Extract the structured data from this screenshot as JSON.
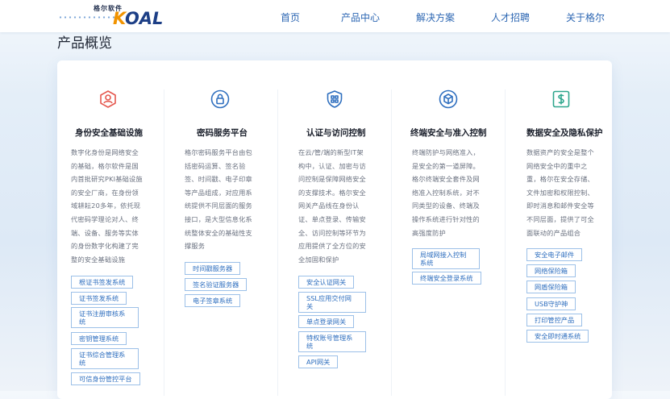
{
  "header": {
    "logo_cn": "格尔软件",
    "logo_brand_k": "K",
    "logo_brand_rest": "OAL",
    "nav": [
      "首页",
      "产品中心",
      "解决方案",
      "人才招聘",
      "关于格尔"
    ]
  },
  "page_title": "产品概览",
  "colors": {
    "accent": "#2f6fbf",
    "icon_red": "#e5584f",
    "icon_blue": "#2f6fbf",
    "icon_green": "#2ea68d"
  },
  "columns": [
    {
      "icon": "user-shield-icon",
      "title": "身份安全基础设施",
      "desc": [
        "数字化身份是网络安全",
        "的基础，格尔软件是国",
        "内首批研究PKI基础设施",
        "的安全厂商，在身份领",
        "域耕耘20多年，依托现",
        "代密码学理论对人、终",
        "端、设备、服务等实体",
        "的身份数字化构建了完",
        "整的安全基础设施"
      ],
      "tags": [
        "根证书签发系统",
        "证书签发系统",
        "证书注册审核系统",
        "密钥管理系统",
        "证书综合管理系统",
        "可信身份管控平台"
      ]
    },
    {
      "icon": "lock-icon",
      "title": "密码服务平台",
      "desc": [
        "格尔密码服务平台由包",
        "括密码运算、签名验",
        "签、时间戳、电子印章",
        "等产品组成，对应用系",
        "统提供不同层面的服务",
        "接口，是大型信息化系",
        "统整体安全的基础性支",
        "撑服务"
      ],
      "tags": [
        "时间戳服务器",
        "签名验证服务器",
        "电子签章系统"
      ]
    },
    {
      "icon": "shield-access-icon",
      "title": "认证与访问控制",
      "desc": [
        "在云/管/端的新型IT架",
        "构中，认证、加密与访",
        "问控制是保障网络安全",
        "的支撑技术。格尔安全",
        "网关产品线在身份认",
        "证、单点登录、传输安",
        "全、访问控制等环节为",
        "应用提供了全方位的安",
        "全加固和保护"
      ],
      "tags": [
        "安全认证网关",
        "SSL应用交付网关",
        "单点登录网关",
        "特权账号管理系统",
        "API网关"
      ]
    },
    {
      "icon": "cube-icon",
      "title": "终端安全与准入控制",
      "desc": [
        "终端防护与网络准入，",
        "是安全的第一道屏障。",
        "格尔终端安全套件及网",
        "络准入控制系统，对不",
        "同类型的设备、终端及",
        "操作系统进行针对性的",
        "高强度防护"
      ],
      "tags": [
        "局域网接入控制系统",
        "终端安全登录系统"
      ]
    },
    {
      "icon": "data-privacy-icon",
      "title": "数据安全及隐私保护",
      "desc": [
        "数据资产的安全是整个",
        "网络安全中的重中之",
        "重，格尔在安全存储、",
        "文件加密和权限控制、",
        "即时消息和邮件安全等",
        "不同层面，提供了可全",
        "面联动的产品组合"
      ],
      "tags": [
        "安全电子邮件",
        "网络保险箱",
        "网盾保险箱",
        "USB守护神",
        "打印管控产品",
        "安全即时通系统"
      ]
    }
  ]
}
